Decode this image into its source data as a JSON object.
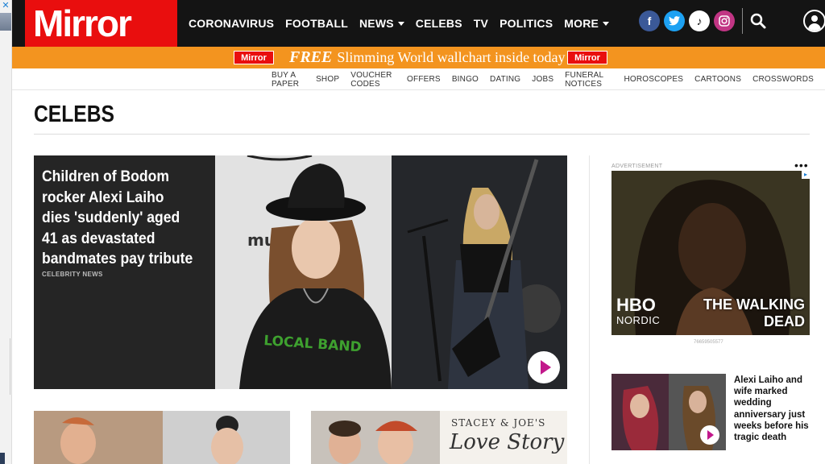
{
  "site": {
    "logo_text": "Mirror",
    "brand_color": "#e90e0e"
  },
  "nav": {
    "items": [
      {
        "label": "CORONAVIRUS",
        "dropdown": false
      },
      {
        "label": "FOOTBALL",
        "dropdown": false
      },
      {
        "label": "NEWS",
        "dropdown": true
      },
      {
        "label": "CELEBS",
        "dropdown": false
      },
      {
        "label": "TV",
        "dropdown": false
      },
      {
        "label": "POLITICS",
        "dropdown": false
      },
      {
        "label": "MORE",
        "dropdown": true
      }
    ],
    "social": [
      {
        "icon": "facebook-icon",
        "glyph": "f"
      },
      {
        "icon": "twitter-icon",
        "glyph": "t"
      },
      {
        "icon": "tiktok-icon",
        "glyph": "♪"
      },
      {
        "icon": "instagram-icon",
        "glyph": "◎"
      }
    ]
  },
  "promo": {
    "mini_logo": "Mirror",
    "free": "FREE",
    "text": "Slimming World wallchart inside today",
    "color": "#f3941f"
  },
  "subnav": {
    "items": [
      "BUY A PAPER",
      "SHOP",
      "VOUCHER CODES",
      "OFFERS",
      "BINGO",
      "DATING",
      "JOBS",
      "FUNERAL NOTICES",
      "HOROSCOPES",
      "CARTOONS",
      "CROSSWORDS"
    ]
  },
  "page": {
    "title": "CELEBS"
  },
  "hero": {
    "headline": "Children of Bodom rocker Alexi Laiho dies 'suddenly' aged 41 as devastated bandmates pay tribute",
    "kicker": "CELEBRITY NEWS",
    "tshirt_text": "LOCAL BAND",
    "backdrop_text": "mus"
  },
  "ad": {
    "label": "ADVERTISEMENT",
    "menu": "•••",
    "brand_top": "HBO",
    "brand_sub": "NORDIC",
    "show_line1": "THE WALKING",
    "show_line2": "DEAD",
    "id": "76659505577"
  },
  "side_story": {
    "headline": "Alexi Laiho and wife marked wedding anniversary just weeks before his tragic death"
  },
  "card2": {
    "sign_line1": "STACEY & JOE'S",
    "sign_line2": "Love Story"
  }
}
